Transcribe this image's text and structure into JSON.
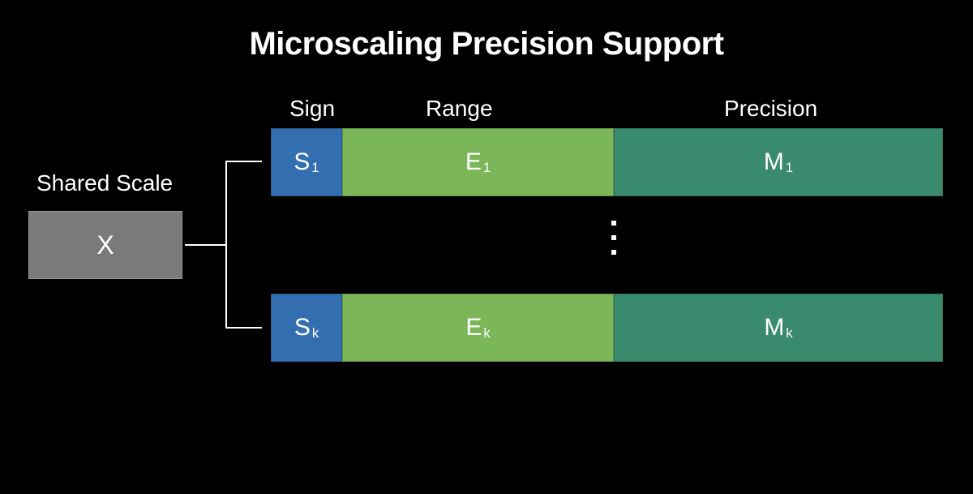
{
  "title": "Microscaling Precision Support",
  "shared_scale": {
    "label": "Shared Scale",
    "value": "X"
  },
  "columns": {
    "sign": "Sign",
    "range": "Range",
    "precision": "Precision"
  },
  "rows": [
    {
      "sign_base": "S",
      "sign_sub": "1",
      "range_base": "E",
      "range_sub": "1",
      "precision_base": "M",
      "precision_sub": "1"
    },
    {
      "sign_base": "S",
      "sign_sub": "k",
      "range_base": "E",
      "range_sub": "k",
      "precision_base": "M",
      "precision_sub": "k"
    }
  ],
  "colors": {
    "sign": "#336fb0",
    "range": "#7bb659",
    "precision": "#3a8a6d",
    "shared": "#7a7a7a"
  }
}
